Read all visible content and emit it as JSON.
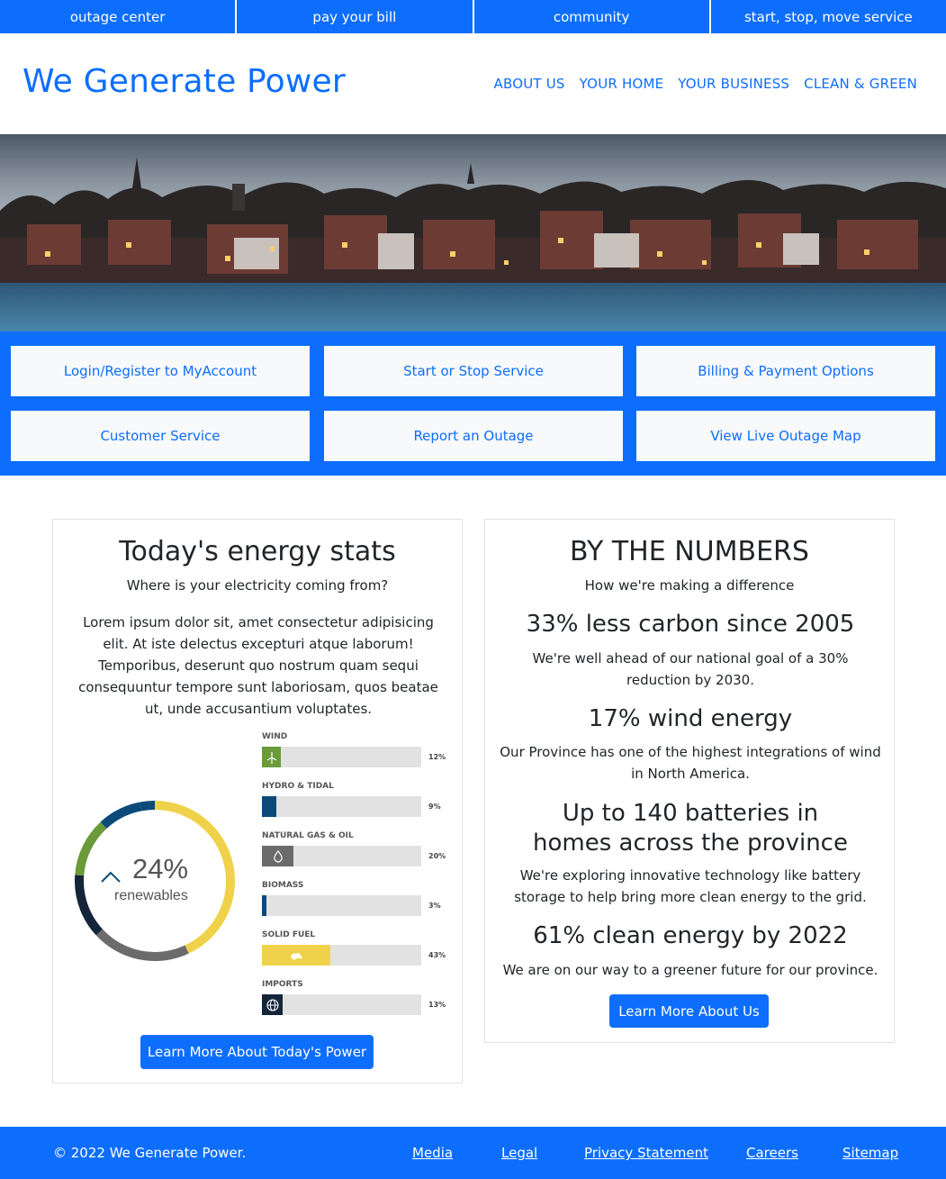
{
  "utility_nav": [
    "outage center",
    "pay your bill",
    "community",
    "start, stop, move service"
  ],
  "brand": "We Generate Power",
  "main_nav": [
    "ABOUT US",
    "YOUR HOME",
    "YOUR BUSINESS",
    "CLEAN & GREEN"
  ],
  "quick_links": [
    "Login/Register to MyAccount",
    "Start or Stop Service",
    "Billing & Payment Options",
    "Customer Service",
    "Report an Outage",
    "View Live Outage Map"
  ],
  "energy": {
    "title": "Today's energy stats",
    "subtitle": "Where is your electricity coming from?",
    "body": "Lorem ipsum dolor sit, amet consectetur adipisicing elit. At iste delectus excepturi atque laborum! Temporibus, deserunt quo nostrum quam sequi consequuntur tempore sunt laboriosam, quos beatae ut, unde accusantium voluptates.",
    "donut_value": "24%",
    "donut_label": "renewables",
    "button": "Learn More About Today's Power",
    "sources": [
      {
        "label": "WIND",
        "pct": "12%",
        "value": 12,
        "color": "#6a9a3a",
        "icon": "wind-turbine-icon"
      },
      {
        "label": "HYDRO & TIDAL",
        "pct": "9%",
        "value": 9,
        "color": "#0c4a7a",
        "icon": "none"
      },
      {
        "label": "NATURAL GAS & OIL",
        "pct": "20%",
        "value": 20,
        "color": "#6b6b6b",
        "icon": "droplet-icon"
      },
      {
        "label": "BIOMASS",
        "pct": "3%",
        "value": 3,
        "color": "#0c4a7a",
        "icon": "none"
      },
      {
        "label": "SOLID FUEL",
        "pct": "43%",
        "value": 43,
        "color": "#f0d24a",
        "icon": "cloud-icon"
      },
      {
        "label": "IMPORTS",
        "pct": "13%",
        "value": 13,
        "color": "#14253a",
        "icon": "globe-icon"
      }
    ]
  },
  "numbers": {
    "title": "BY THE NUMBERS",
    "subtitle": "How we're making a difference",
    "stats": [
      {
        "heading": "33% less carbon since 2005",
        "text": "We're well ahead of our national goal of a 30% reduction by 2030."
      },
      {
        "heading": "17% wind energy",
        "text": "Our Province has one of the highest integrations of wind in North America."
      },
      {
        "heading": "Up to 140 batteries in homes across the province",
        "text": "We're exploring innovative technology like battery storage to help bring more clean energy to the grid."
      },
      {
        "heading": "61% clean energy by 2022",
        "text": "We are on our way to a greener future for our province."
      }
    ],
    "button": "Learn More About Us"
  },
  "footer": {
    "copyright": "© 2022 We Generate Power.",
    "links": [
      "Media",
      "Legal",
      "Privacy Statement",
      "Careers",
      "Sitemap"
    ]
  },
  "colors": {
    "primary": "#0d6efd",
    "light": "#f8f9fa"
  }
}
